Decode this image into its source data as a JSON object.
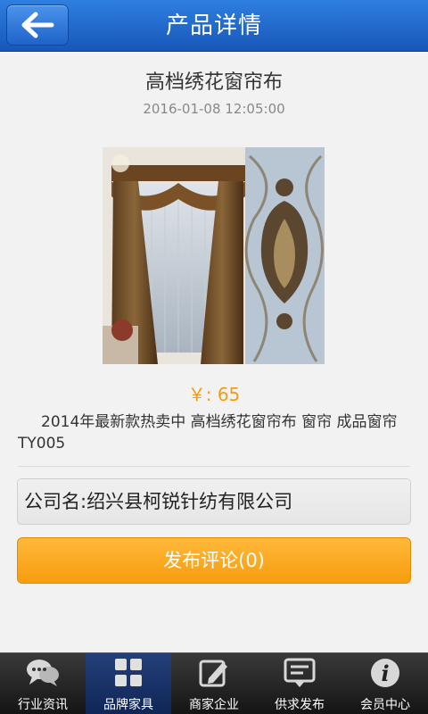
{
  "header": {
    "title": "产品详情"
  },
  "product": {
    "title": "高档绣花窗帘布",
    "date": "2016-01-08 12:05:00",
    "price": "￥: 65",
    "description": "2014年最新款热卖中 高档绣花窗帘布 窗帘 成品窗帘 TY005",
    "company": "公司名:绍兴县柯锐针纺有限公司"
  },
  "actions": {
    "comment_label": "发布评论(0)"
  },
  "tabbar": {
    "tabs": [
      {
        "label": "行业资讯",
        "icon": "chat-bubbles-icon"
      },
      {
        "label": "品牌家具",
        "icon": "grid-icon"
      },
      {
        "label": "商家企业",
        "icon": "edit-icon"
      },
      {
        "label": "供求发布",
        "icon": "message-icon"
      },
      {
        "label": "会员中心",
        "icon": "info-icon"
      }
    ],
    "active_index": 1
  },
  "colors": {
    "header": "#1f6ad0",
    "price": "#f39c12",
    "button": "#f9a820",
    "tab_active": "#1a3366"
  }
}
